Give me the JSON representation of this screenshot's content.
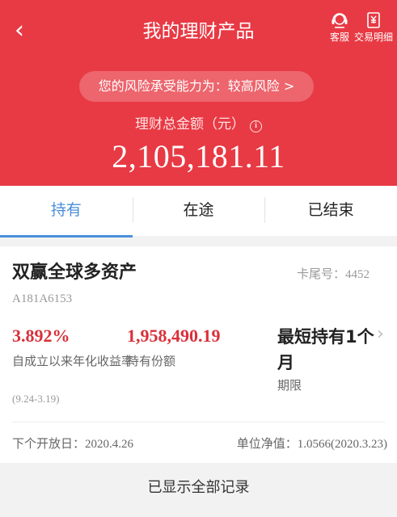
{
  "header": {
    "back_glyph": "‹",
    "title": "我的理财产品",
    "service_label": "客服",
    "details_label": "交易明细",
    "risk_text": "您的风险承受能力为：较高风险 >",
    "total_label": "理财总金额（元）",
    "info_glyph": "i",
    "total_amount": "2,105,181.11",
    "bg_color": "#e83a44"
  },
  "tabs": [
    {
      "label": "持有",
      "active": true
    },
    {
      "label": "在途",
      "active": false
    },
    {
      "label": "已结束",
      "active": false
    }
  ],
  "product": {
    "name": "双赢全球多资产",
    "tail_label": "卡尾号：",
    "tail_number": "4452",
    "code": "A181A6153",
    "rate": "3.892%",
    "rate_label": "自成立以来年化收益率",
    "rate_range": "(9.24-3.19)",
    "share": "1,958,490.19",
    "share_label": "持有份额",
    "period": "最短持有1个月",
    "period_label": "期限",
    "chevron_glyph": "›",
    "next_open_label": "下个开放日：",
    "next_open_date": "2020.4.26",
    "nav_label": "单位净值：",
    "nav_value": "1.0566(2020.3.23)",
    "accent_red": "#d9303a"
  },
  "footer": {
    "text": "已显示全部记录"
  },
  "colors": {
    "tab_active": "#4a8fd9"
  }
}
